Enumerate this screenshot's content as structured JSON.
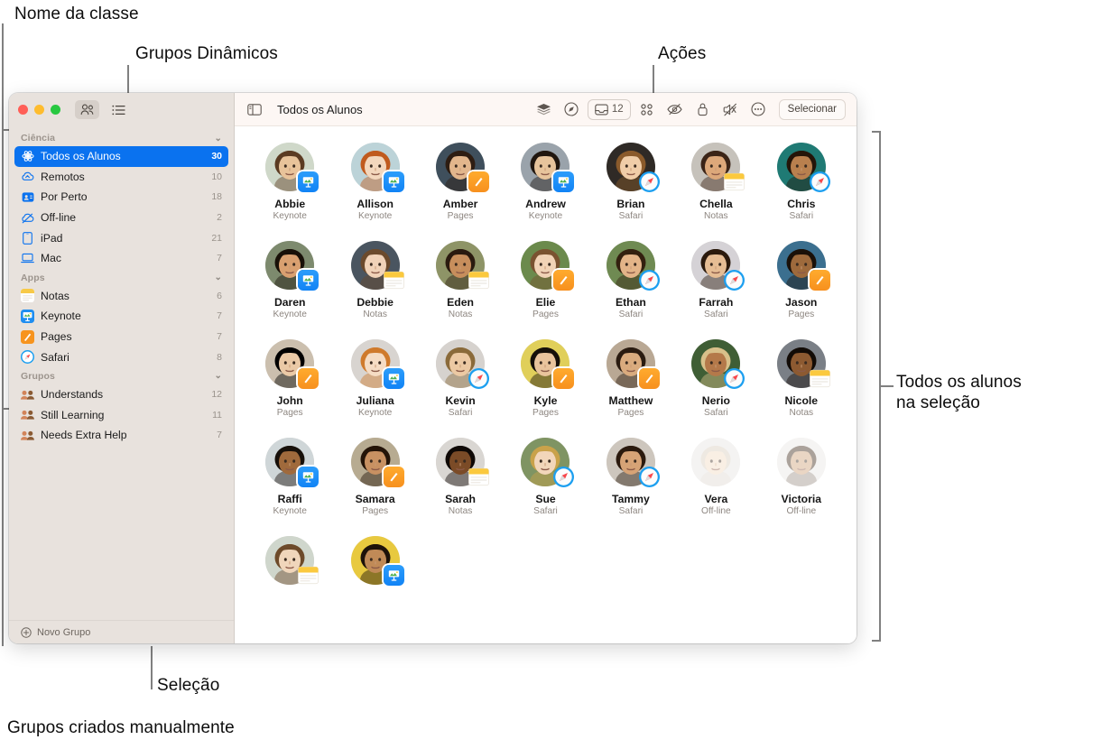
{
  "annotations": [
    {
      "id": "class-name",
      "text": "Nome da classe"
    },
    {
      "id": "dynamic-groups",
      "text": "Grupos Dinâmicos"
    },
    {
      "id": "actions",
      "text": "Ações"
    },
    {
      "id": "all-students",
      "text": "Todos os alunos\nna seleção"
    },
    {
      "id": "selection",
      "text": "Seleção"
    },
    {
      "id": "manual-groups",
      "text": "Grupos criados manualmente"
    }
  ],
  "window": {
    "sidebar": {
      "view_toggle": {
        "people_icon": "people-icon",
        "list_icon": "list-icon",
        "active": "people"
      },
      "sections": [
        {
          "title": "Ciência",
          "items": [
            {
              "label": "Todos os Alunos",
              "count": "30",
              "icon": "atom-icon",
              "selected": true
            },
            {
              "label": "Remotos",
              "count": "10",
              "icon": "cloud-icon",
              "selected": false
            },
            {
              "label": "Por Perto",
              "count": "18",
              "icon": "nearby-icon",
              "selected": false
            },
            {
              "label": "Off-line",
              "count": "2",
              "icon": "cloud-slash-icon",
              "selected": false
            },
            {
              "label": "iPad",
              "count": "21",
              "icon": "ipad-icon",
              "selected": false
            },
            {
              "label": "Mac",
              "count": "7",
              "icon": "mac-icon",
              "selected": false
            }
          ]
        },
        {
          "title": "Apps",
          "items": [
            {
              "label": "Notas",
              "count": "6",
              "icon": "notes-app-icon",
              "selected": false
            },
            {
              "label": "Keynote",
              "count": "7",
              "icon": "keynote-app-icon",
              "selected": false
            },
            {
              "label": "Pages",
              "count": "7",
              "icon": "pages-app-icon",
              "selected": false
            },
            {
              "label": "Safari",
              "count": "8",
              "icon": "safari-app-icon",
              "selected": false
            }
          ]
        },
        {
          "title": "Grupos",
          "items": [
            {
              "label": "Understands",
              "count": "12",
              "icon": "group-icon",
              "selected": false
            },
            {
              "label": "Still Learning",
              "count": "11",
              "icon": "group-icon",
              "selected": false
            },
            {
              "label": "Needs Extra Help",
              "count": "7",
              "icon": "group-icon",
              "selected": false
            }
          ]
        }
      ],
      "footer": {
        "label": "Novo Grupo",
        "icon": "plus-circle-icon"
      }
    },
    "toolbar": {
      "sidebar_toggle_icon": "sidebar-toggle-icon",
      "title": "Todos os Alunos",
      "actions": [
        {
          "name": "layers-icon",
          "label": ""
        },
        {
          "name": "navigate-icon",
          "label": ""
        },
        {
          "name": "inbox-icon",
          "label": "12"
        },
        {
          "name": "apps-grid-icon",
          "label": ""
        },
        {
          "name": "eye-slash-icon",
          "label": ""
        },
        {
          "name": "lock-icon",
          "label": ""
        },
        {
          "name": "mute-icon",
          "label": ""
        },
        {
          "name": "more-icon",
          "label": ""
        }
      ],
      "select_button": "Selecionar"
    },
    "students": [
      {
        "name": "Abbie",
        "status": "Keynote",
        "app": "keynote",
        "skin": "#e8c39a",
        "hair": "#5b3b22",
        "bg": "#cfd8c9"
      },
      {
        "name": "Allison",
        "status": "Keynote",
        "app": "keynote",
        "skin": "#f3d7bd",
        "hair": "#c05a1e",
        "bg": "#bcd3d8"
      },
      {
        "name": "Amber",
        "status": "Pages",
        "app": "pages",
        "skin": "#e2b68c",
        "hair": "#2e1d12",
        "bg": "#3f4f5c"
      },
      {
        "name": "Andrew",
        "status": "Keynote",
        "app": "keynote",
        "skin": "#e7c49c",
        "hair": "#20160f",
        "bg": "#9aa3ab"
      },
      {
        "name": "Brian",
        "status": "Safari",
        "app": "safari",
        "skin": "#f0cda8",
        "hair": "#8a5a2b",
        "bg": "#2f2a26"
      },
      {
        "name": "Chella",
        "status": "Notas",
        "app": "notas",
        "skin": "#dda87a",
        "hair": "#3b2417",
        "bg": "#c6c2bb"
      },
      {
        "name": "Chris",
        "status": "Safari",
        "app": "safari",
        "skin": "#b9804e",
        "hair": "#241509",
        "bg": "#1f7a74"
      },
      {
        "name": "Daren",
        "status": "Keynote",
        "app": "keynote",
        "skin": "#d9a070",
        "hair": "#181008",
        "bg": "#7d8a6e"
      },
      {
        "name": "Debbie",
        "status": "Notas",
        "app": "notas",
        "skin": "#f0d2b8",
        "hair": "#6b4a2c",
        "bg": "#4a5560"
      },
      {
        "name": "Eden",
        "status": "Notas",
        "app": "notas",
        "skin": "#c78e5c",
        "hair": "#2a1a0f",
        "bg": "#8e9467"
      },
      {
        "name": "Elie",
        "status": "Pages",
        "app": "pages",
        "skin": "#f1d3b6",
        "hair": "#7a5330",
        "bg": "#6b8a4c"
      },
      {
        "name": "Ethan",
        "status": "Safari",
        "app": "safari",
        "skin": "#e3b488",
        "hair": "#33200f",
        "bg": "#6f8a52"
      },
      {
        "name": "Farrah",
        "status": "Safari",
        "app": "safari",
        "skin": "#e6bd94",
        "hair": "#2b1a0d",
        "bg": "#d5d2d6"
      },
      {
        "name": "Jason",
        "status": "Pages",
        "app": "pages",
        "skin": "#9e6a3c",
        "hair": "#1a1008",
        "bg": "#3b6f8f"
      },
      {
        "name": "John",
        "status": "Pages",
        "app": "pages",
        "skin": "#eac9a6",
        "hair": "#4b3venue",
        "bg": "#cbbfae"
      },
      {
        "name": "Juliana",
        "status": "Keynote",
        "app": "keynote",
        "skin": "#f5dcc4",
        "hair": "#cf7a2c",
        "bg": "#d8d4d0"
      },
      {
        "name": "Kevin",
        "status": "Safari",
        "app": "safari",
        "skin": "#ecc9a3",
        "hair": "#8a6a3a",
        "bg": "#d6d2ce"
      },
      {
        "name": "Kyle",
        "status": "Pages",
        "app": "pages",
        "skin": "#e9c49c",
        "hair": "#16100a",
        "bg": "#e0cf5a"
      },
      {
        "name": "Matthew",
        "status": "Pages",
        "app": "pages",
        "skin": "#d9ab7e",
        "hair": "#2a1b10",
        "bg": "#b9a894"
      },
      {
        "name": "Nerio",
        "status": "Safari",
        "app": "safari",
        "skin": "#b4794a",
        "hair": "#d8c08a",
        "bg": "#3f5e35"
      },
      {
        "name": "Nicole",
        "status": "Notas",
        "app": "notas",
        "skin": "#8d5a31",
        "hair": "#120b06",
        "bg": "#7a7f86"
      },
      {
        "name": "Raffi",
        "status": "Keynote",
        "app": "keynote",
        "skin": "#a06a3c",
        "hair": "#17100a",
        "bg": "#cfd6d8"
      },
      {
        "name": "Samara",
        "status": "Pages",
        "app": "pages",
        "skin": "#c89162",
        "hair": "#241408",
        "bg": "#b7ab91"
      },
      {
        "name": "Sarah",
        "status": "Notas",
        "app": "notas",
        "skin": "#7b4b27",
        "hair": "#0f0906",
        "bg": "#d9d6d2"
      },
      {
        "name": "Sue",
        "status": "Safari",
        "app": "safari",
        "skin": "#f2d6ba",
        "hair": "#c9a24a",
        "bg": "#7f9463"
      },
      {
        "name": "Tammy",
        "status": "Safari",
        "app": "safari",
        "skin": "#d6a376",
        "hair": "#2b1a0e",
        "bg": "#cdc6bd"
      },
      {
        "name": "Vera",
        "status": "Off-line",
        "app": "none",
        "skin": "#f3dac0",
        "hair": "#d8cdbc",
        "bg": "#e6e4e1"
      },
      {
        "name": "Victoria",
        "status": "Off-line",
        "app": "none",
        "skin": "#cf9f75",
        "hair": "#3a2414",
        "bg": "#e9e6e3"
      },
      {
        "name": "",
        "status": "",
        "app": "notas",
        "skin": "#f0d6bb",
        "hair": "#6d4a2a",
        "bg": "#cfd6cc"
      },
      {
        "name": "",
        "status": "",
        "app": "keynote",
        "skin": "#c08a57",
        "hair": "#1d120a",
        "bg": "#e8c93f"
      }
    ]
  }
}
